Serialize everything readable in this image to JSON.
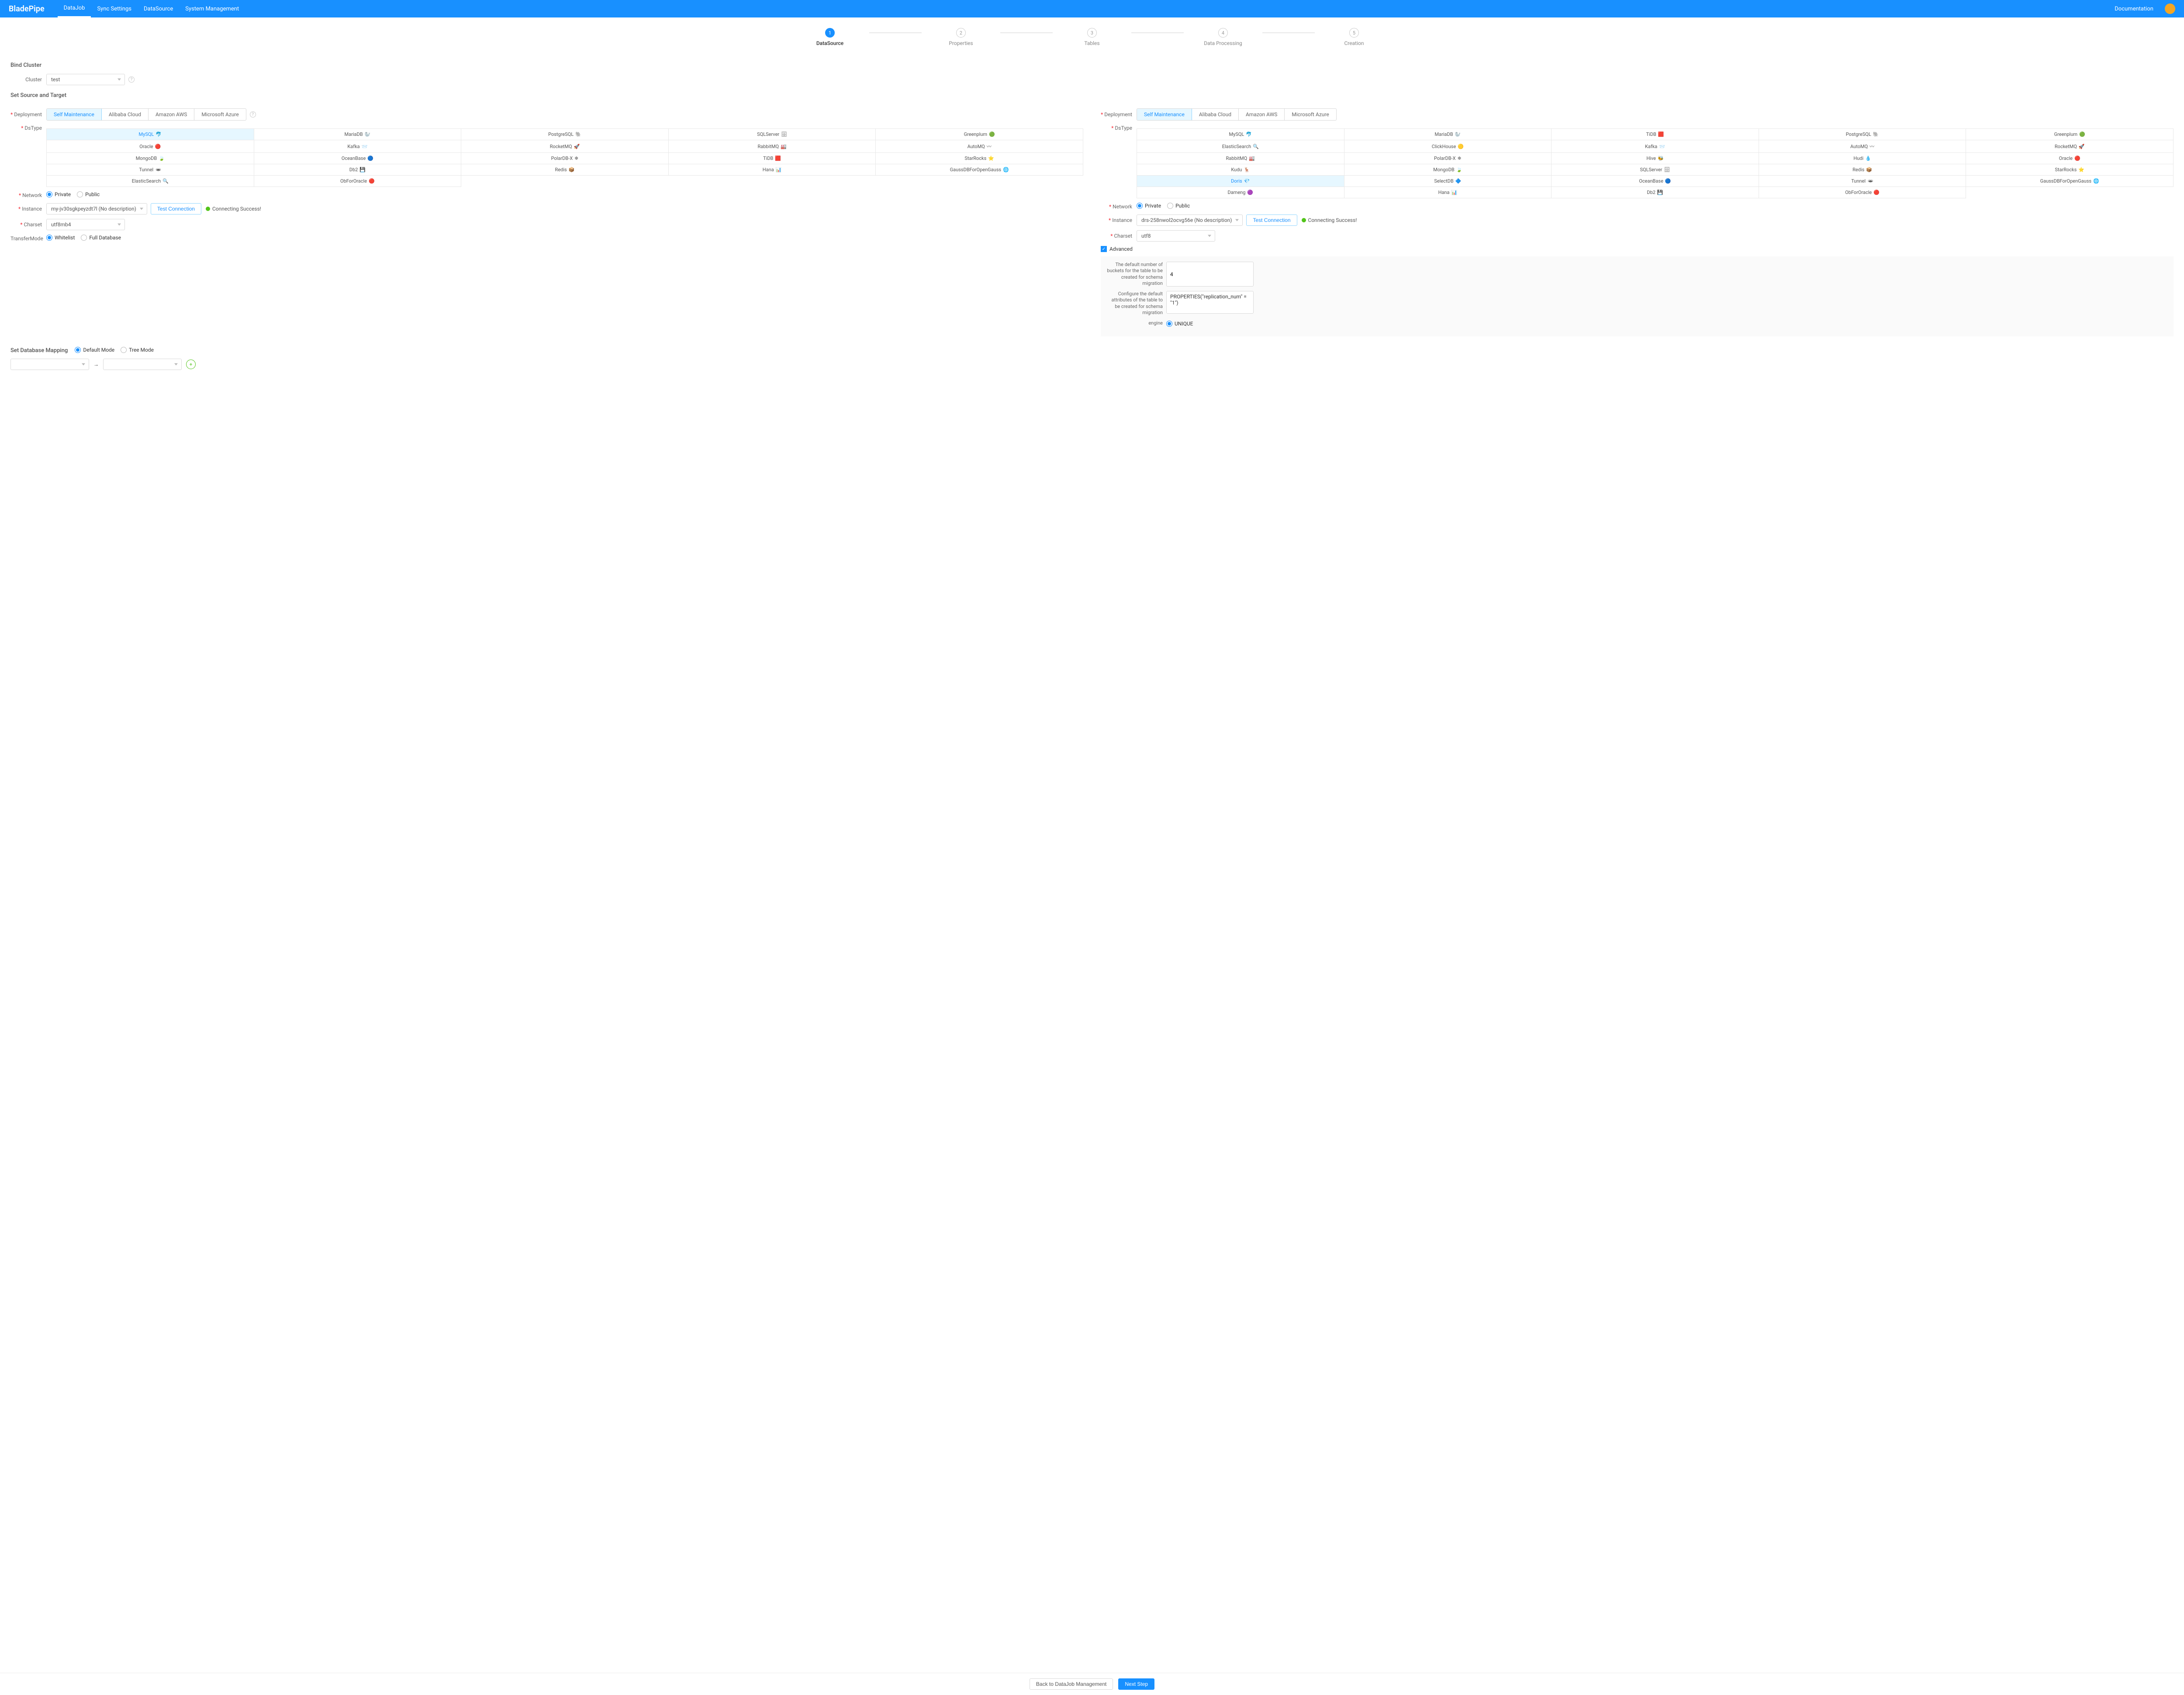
{
  "nav": {
    "logo": "BladePipe",
    "items": [
      "DataJob",
      "Sync Settings",
      "DataSource",
      "System Management"
    ],
    "activeIndex": 0,
    "documentation": "Documentation"
  },
  "steps": {
    "items": [
      "DataSource",
      "Properties",
      "Tables",
      "Data Processing",
      "Creation"
    ],
    "activeIndex": 0
  },
  "sections": {
    "bindCluster": "Bind Cluster",
    "setSourceTarget": "Set Source and Target",
    "setDbMapping": "Set Database Mapping"
  },
  "cluster": {
    "label": "Cluster",
    "value": "test"
  },
  "deploymentLabel": "Deployment",
  "deploymentTabs": [
    "Self Maintenance",
    "Alibaba Cloud",
    "Amazon AWS",
    "Microsoft Azure"
  ],
  "dsTypeLabel": "DsType",
  "networkLabel": "Network",
  "networkOptions": [
    "Private",
    "Public"
  ],
  "instanceLabel": "Instance",
  "testConnection": "Test Connection",
  "connectingSuccess": "Connecting Success!",
  "charsetLabel": "Charset",
  "transferModeLabel": "TransferMode",
  "transferModeOptions": [
    "Whitelist",
    "Full Database"
  ],
  "advancedLabel": "Advanced",
  "source": {
    "deploymentActive": 0,
    "dsTypes": [
      {
        "n": "MySQL",
        "i": "🐬"
      },
      {
        "n": "MariaDB",
        "i": "🦭"
      },
      {
        "n": "PostgreSQL",
        "i": "🐘"
      },
      {
        "n": "SQLServer",
        "i": "🗄"
      },
      {
        "n": "Greenplum",
        "i": "🟢"
      },
      {
        "n": "Oracle",
        "i": "🔴"
      },
      {
        "n": "Kafka",
        "i": "📨"
      },
      {
        "n": "RocketMQ",
        "i": "🚀"
      },
      {
        "n": "RabbitMQ",
        "i": "🏭"
      },
      {
        "n": "AutoMQ",
        "i": "〰"
      },
      {
        "n": "MongoDB",
        "i": "🍃"
      },
      {
        "n": "OceanBase",
        "i": "🔵"
      },
      {
        "n": "PolarDB-X",
        "i": "❄"
      },
      {
        "n": "TiDB",
        "i": "🟥"
      },
      {
        "n": "StarRocks",
        "i": "⭐"
      },
      {
        "n": "Tunnel",
        "i": "🕳"
      },
      {
        "n": "Db2",
        "i": "💾"
      },
      {
        "n": "Redis",
        "i": "📦"
      },
      {
        "n": "Hana",
        "i": "📊"
      },
      {
        "n": "GaussDBForOpenGauss",
        "i": "🌐"
      },
      {
        "n": "ElasticSearch",
        "i": "🔍"
      },
      {
        "n": "ObForOracle",
        "i": "🔴"
      }
    ],
    "dsSelected": 0,
    "networkSelected": 0,
    "instance": "my-jv30sgkpeyzdt7l (No description)",
    "charset": "utf8mb4",
    "transferModeSelected": 0
  },
  "target": {
    "deploymentActive": 0,
    "dsTypes": [
      {
        "n": "MySQL",
        "i": "🐬"
      },
      {
        "n": "MariaDB",
        "i": "🦭"
      },
      {
        "n": "TiDB",
        "i": "🟥"
      },
      {
        "n": "PostgreSQL",
        "i": "🐘"
      },
      {
        "n": "Greenplum",
        "i": "🟢"
      },
      {
        "n": "ElasticSearch",
        "i": "🔍"
      },
      {
        "n": "ClickHouse",
        "i": "🟡"
      },
      {
        "n": "Kafka",
        "i": "📨"
      },
      {
        "n": "AutoMQ",
        "i": "〰"
      },
      {
        "n": "RocketMQ",
        "i": "🚀"
      },
      {
        "n": "RabbitMQ",
        "i": "🏭"
      },
      {
        "n": "PolarDB-X",
        "i": "❄"
      },
      {
        "n": "Hive",
        "i": "🐝"
      },
      {
        "n": "Hudi",
        "i": "💧"
      },
      {
        "n": "Oracle",
        "i": "🔴"
      },
      {
        "n": "Kudu",
        "i": "🦌"
      },
      {
        "n": "MongoDB",
        "i": "🍃"
      },
      {
        "n": "SQLServer",
        "i": "🗄"
      },
      {
        "n": "Redis",
        "i": "📦"
      },
      {
        "n": "StarRocks",
        "i": "⭐"
      },
      {
        "n": "Doris",
        "i": "💎"
      },
      {
        "n": "SelectDB",
        "i": "🔷"
      },
      {
        "n": "OceanBase",
        "i": "🔵"
      },
      {
        "n": "Tunnel",
        "i": "🕳"
      },
      {
        "n": "GaussDBForOpenGauss",
        "i": "🌐"
      },
      {
        "n": "Dameng",
        "i": "🟣"
      },
      {
        "n": "Hana",
        "i": "📊"
      },
      {
        "n": "Db2",
        "i": "💾"
      },
      {
        "n": "ObForOracle",
        "i": "🔴"
      }
    ],
    "dsSelected": 20,
    "networkSelected": 0,
    "instance": "drs-258nwol2ocvg56e (No description)",
    "charset": "utf8",
    "advanced": {
      "bucketsLabel": "The default number of buckets for the table to be created for schema migration",
      "bucketsValue": "4",
      "attrsLabel": "Configure the default attributes of the table to be created for schema migration",
      "attrsValue": "PROPERTIES(\"replication_num\" = \"1\")",
      "engineLabel": "engine",
      "engineOption": "UNIQUE"
    }
  },
  "dbMapping": {
    "options": [
      "Default Mode",
      "Tree Mode"
    ],
    "selected": 0
  },
  "footer": {
    "back": "Back to DataJob Management",
    "next": "Next Step"
  }
}
